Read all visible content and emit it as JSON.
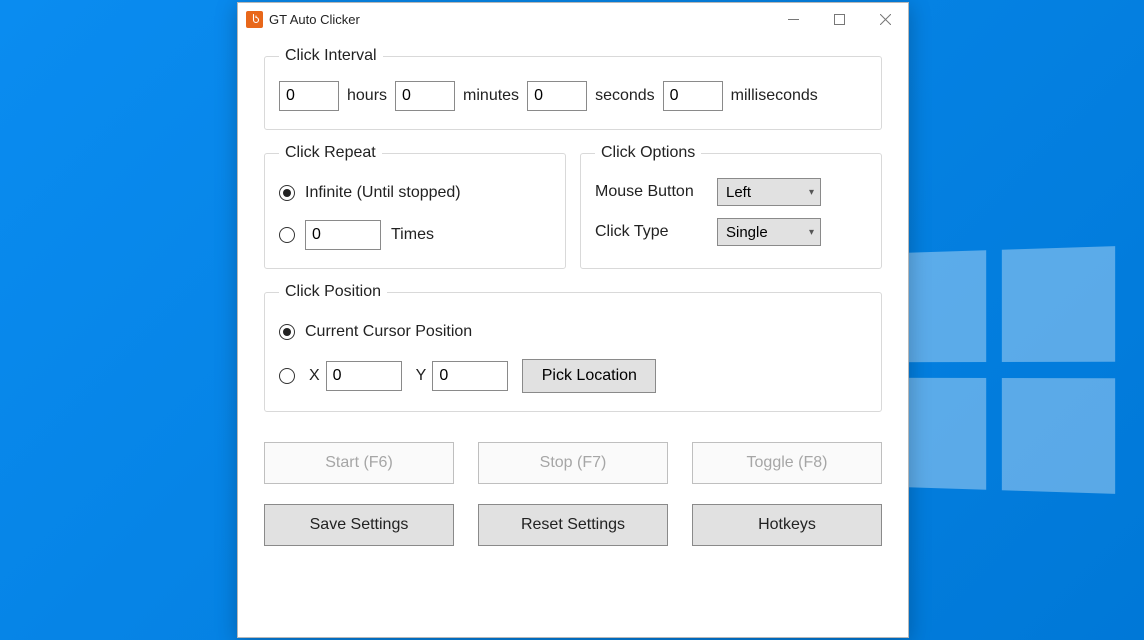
{
  "window": {
    "title": "GT Auto Clicker"
  },
  "interval": {
    "legend": "Click Interval",
    "hours": {
      "value": "0",
      "label": "hours"
    },
    "minutes": {
      "value": "0",
      "label": "minutes"
    },
    "seconds": {
      "value": "0",
      "label": "seconds"
    },
    "milliseconds": {
      "value": "0",
      "label": "milliseconds"
    }
  },
  "repeat": {
    "legend": "Click Repeat",
    "infinite_label": "Infinite (Until stopped)",
    "infinite_checked": true,
    "times_value": "0",
    "times_label": "Times",
    "times_checked": false
  },
  "options": {
    "legend": "Click Options",
    "mouse_button_label": "Mouse Button",
    "mouse_button_value": "Left",
    "click_type_label": "Click Type",
    "click_type_value": "Single"
  },
  "position": {
    "legend": "Click Position",
    "current_label": "Current Cursor Position",
    "current_checked": true,
    "xy_checked": false,
    "x_label": "X",
    "x_value": "0",
    "y_label": "Y",
    "y_value": "0",
    "pick_label": "Pick Location"
  },
  "buttons": {
    "start": "Start (F6)",
    "stop": "Stop (F7)",
    "toggle": "Toggle (F8)",
    "save": "Save Settings",
    "reset": "Reset Settings",
    "hotkeys": "Hotkeys"
  }
}
